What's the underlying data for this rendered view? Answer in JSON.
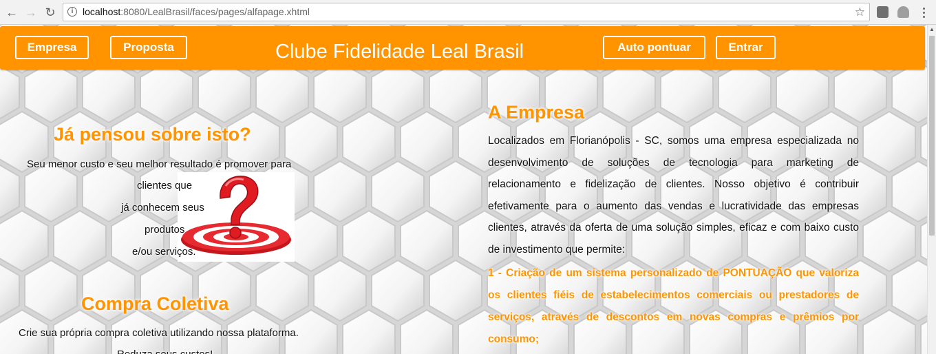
{
  "browser": {
    "url_host": "localhost",
    "url_path": ":8080/LealBrasil/faces/pages/alfapage.xhtml"
  },
  "header": {
    "buttons_left": [
      "Empresa",
      "Proposta"
    ],
    "title": "Clube Fidelidade Leal Brasil",
    "buttons_right": [
      "Auto pontuar",
      "Entrar"
    ],
    "accent_color": "#ff9400"
  },
  "left": {
    "heading1": "Já pensou sobre isto?",
    "para1": [
      "Seu menor custo e seu melhor resultado é promover para",
      "clientes que",
      "já conhecem seus",
      "produtos",
      "e/ou serviços."
    ],
    "heading2": "Compra Coletiva",
    "para2": [
      "Crie sua própria compra coletiva utilizando nossa plataforma.",
      "Reduza seus custos!"
    ]
  },
  "right": {
    "heading": "A Empresa",
    "paragraph": "Localizados em Florianópolis - SC, somos uma empresa especializada no desenvolvimento de soluções de tecnologia para marketing de relacionamento e fidelização de clientes. Nosso objetivo é contribuir efetivamente para o aumento das vendas e lucratividade das empresas clientes, através da oferta de uma solução simples, eficaz e com baixo custo de investimento que permite:",
    "item1": "1 - Criação de um sistema personalizado de PONTUAÇÃO que valoriza os clientes fiéis de estabelecimentos comerciais ou prestadores de serviços, através de descontos em novas compras e prêmios por consumo;"
  }
}
